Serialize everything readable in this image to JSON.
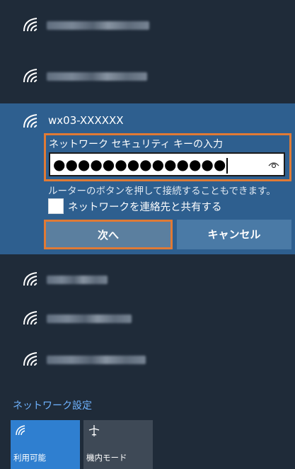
{
  "networks_top": [
    {
      "name": "",
      "blurred": true
    },
    {
      "name": "",
      "blurred": true
    }
  ],
  "selected_network": {
    "ssid": "wx03-XXXXXX",
    "key_label": "ネットワーク セキュリティ キーの入力",
    "key_value": "●●●●●●●●●●●●●●",
    "hint": "ルーターのボタンを押して接続することもできます。",
    "share_label": "ネットワークを連絡先と共有する",
    "share_checked": false,
    "next_label": "次へ",
    "cancel_label": "キャンセル"
  },
  "networks_bottom": [
    {
      "name": "",
      "blurred": true
    },
    {
      "name": "",
      "blurred": true
    },
    {
      "name": "",
      "blurred": true
    }
  ],
  "settings_link": "ネットワーク設定",
  "quick_tiles": [
    {
      "label": "利用可能",
      "icon": "wifi-icon",
      "active": true
    },
    {
      "label": "機内モード",
      "icon": "airplane-icon",
      "active": false
    }
  ],
  "colors": {
    "background": "#1f2b39",
    "selected_bg": "#2e5f8f",
    "highlight_border": "#e07a35",
    "link": "#6fb3ff",
    "active_tile": "#2f7fd0"
  }
}
